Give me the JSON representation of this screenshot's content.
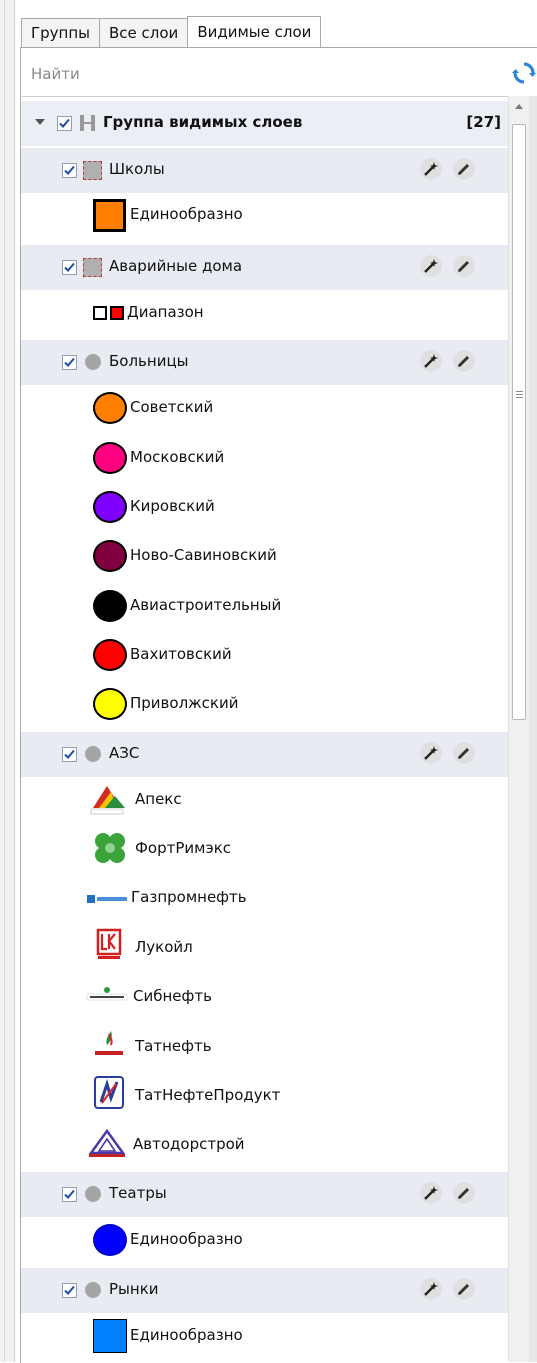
{
  "tabs": [
    {
      "label": "Группы"
    },
    {
      "label": "Все слои"
    },
    {
      "label": "Видимые слои"
    }
  ],
  "search": {
    "placeholder": "Найти"
  },
  "group": {
    "label": "Группа видимых слоев",
    "count": "[27]"
  },
  "layers": [
    {
      "label": "Школы",
      "icon": "dashed-square",
      "legend": [
        {
          "label": "Единообразно",
          "swatch": "square",
          "color": "#ff7f00"
        }
      ]
    },
    {
      "label": "Аварийные дома",
      "icon": "dashed-square",
      "legend": [
        {
          "label": "Диапазон",
          "swatch": "range",
          "colors": [
            "#ffffff",
            "#ff0000"
          ]
        }
      ]
    },
    {
      "label": "Больницы",
      "icon": "dot",
      "legend": [
        {
          "label": "Советский",
          "color": "#ff8000"
        },
        {
          "label": "Московский",
          "color": "#ff0080"
        },
        {
          "label": "Кировский",
          "color": "#8000ff"
        },
        {
          "label": "Ново-Савиновский",
          "color": "#800040"
        },
        {
          "label": "Авиастроительный",
          "color": "#000000"
        },
        {
          "label": "Вахитовский",
          "color": "#ff0000"
        },
        {
          "label": "Приволжский",
          "color": "#ffff00"
        }
      ]
    },
    {
      "label": "АЗС",
      "icon": "dot",
      "legend": [
        {
          "label": "Апекс",
          "logo": "apex-logo"
        },
        {
          "label": "ФортРимэкс",
          "logo": "clover-logo"
        },
        {
          "label": "Газпромнефть",
          "logo": "gazprom-logo"
        },
        {
          "label": "Лукойл",
          "logo": "lukoil-logo"
        },
        {
          "label": "Сибнефть",
          "logo": "sibneft-logo"
        },
        {
          "label": "Татнефть",
          "logo": "tatneft-logo"
        },
        {
          "label": "ТатНефтеПродукт",
          "logo": "tatnefteprodukt-logo"
        },
        {
          "label": "Автодорстрой",
          "logo": "avtodorstroy-logo"
        }
      ]
    },
    {
      "label": "Театры",
      "icon": "dot",
      "legend": [
        {
          "label": "Единообразно",
          "swatch": "circle",
          "color": "#0000ff"
        }
      ]
    },
    {
      "label": "Рынки",
      "icon": "dot",
      "legend": [
        {
          "label": "Единообразно",
          "swatch": "square",
          "color": "#0080ff"
        }
      ]
    }
  ],
  "colors": {
    "row_bg": "#e9ebf3",
    "check": "#1f4fa0"
  }
}
